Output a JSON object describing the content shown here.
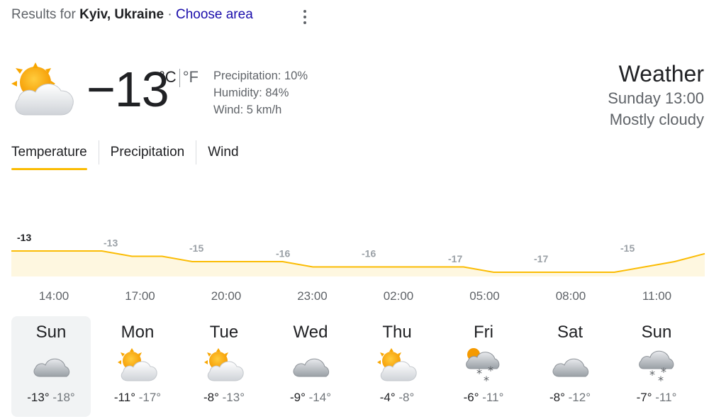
{
  "header": {
    "results_prefix": "Results for",
    "location": "Kyiv, Ukraine",
    "separator": " · ",
    "choose_area": "Choose area",
    "menu_icon": "more-vert-icon"
  },
  "current": {
    "icon": "mostly-cloudy-icon",
    "temperature": "−13",
    "unit_c": "°C",
    "unit_f": "°F",
    "precipitation": "Precipitation: 10%",
    "humidity": "Humidity: 84%",
    "wind": "Wind: 5 km/h",
    "title": "Weather",
    "time": "Sunday 13:00",
    "condition": "Mostly cloudy"
  },
  "tabs": [
    "Temperature",
    "Precipitation",
    "Wind"
  ],
  "chart_data": {
    "type": "area",
    "x": [
      "13:00",
      "14:00",
      "15:00",
      "16:00",
      "17:00",
      "18:00",
      "19:00",
      "20:00",
      "21:00",
      "22:00",
      "23:00",
      "00:00",
      "01:00",
      "02:00",
      "03:00",
      "04:00",
      "05:00",
      "06:00",
      "07:00",
      "08:00",
      "09:00",
      "10:00",
      "11:00",
      "12:00"
    ],
    "values": [
      -13,
      -13,
      -13,
      -13,
      -14,
      -14,
      -15,
      -15,
      -15,
      -15,
      -16,
      -16,
      -16,
      -16,
      -16,
      -16,
      -17,
      -17,
      -17,
      -17,
      -17,
      -16,
      -15,
      -14
    ],
    "data_labels": [
      {
        "x": "14:00",
        "label": "-13"
      },
      {
        "x": "17:00",
        "label": "-13"
      },
      {
        "x": "20:00",
        "label": "-15"
      },
      {
        "x": "23:00",
        "label": "-16"
      },
      {
        "x": "02:00",
        "label": "-16"
      },
      {
        "x": "05:00",
        "label": "-17"
      },
      {
        "x": "08:00",
        "label": "-17"
      },
      {
        "x": "11:00",
        "label": "-15"
      }
    ],
    "tick_labels": [
      "14:00",
      "17:00",
      "20:00",
      "23:00",
      "02:00",
      "05:00",
      "08:00",
      "11:00"
    ],
    "line_color": "#fbbc04",
    "fill_color": "#fef7e0",
    "grid": false
  },
  "forecast": [
    {
      "day": "Sun",
      "icon": "cloudy-icon",
      "high": "-13°",
      "low": "-18°",
      "selected": true
    },
    {
      "day": "Mon",
      "icon": "partly-cloudy-icon",
      "high": "-11°",
      "low": "-17°",
      "selected": false
    },
    {
      "day": "Tue",
      "icon": "partly-cloudy-icon",
      "high": "-8°",
      "low": "-13°",
      "selected": false
    },
    {
      "day": "Wed",
      "icon": "cloudy-icon",
      "high": "-9°",
      "low": "-14°",
      "selected": false
    },
    {
      "day": "Thu",
      "icon": "partly-cloudy-icon",
      "high": "-4°",
      "low": "-8°",
      "selected": false
    },
    {
      "day": "Fri",
      "icon": "snow-partly-cloudy-icon",
      "high": "-6°",
      "low": "-11°",
      "selected": false
    },
    {
      "day": "Sat",
      "icon": "cloudy-icon",
      "high": "-8°",
      "low": "-12°",
      "selected": false
    },
    {
      "day": "Sun",
      "icon": "snow-icon",
      "high": "-7°",
      "low": "-11°",
      "selected": false
    }
  ],
  "colors": {
    "accent": "#fbbc04",
    "link": "#1a0dab",
    "muted": "#5f6368"
  }
}
